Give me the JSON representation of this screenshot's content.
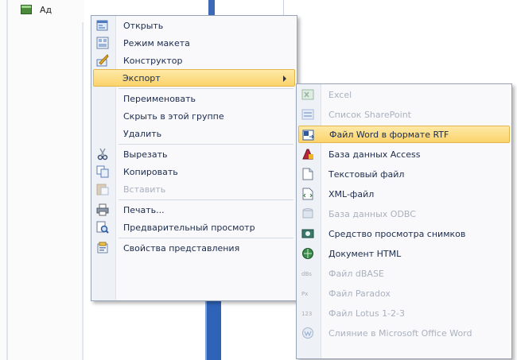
{
  "background": {
    "nav_item_label": "Ад"
  },
  "context_menu": {
    "items": [
      {
        "label": "Открыть",
        "icon": "open-form-icon",
        "disabled": false
      },
      {
        "label": "Режим макета",
        "icon": "layout-view-icon",
        "disabled": false
      },
      {
        "label": "Конструктор",
        "icon": "design-view-icon",
        "disabled": false
      },
      {
        "label": "Экспорт",
        "icon": "",
        "disabled": false,
        "highlighted": true,
        "submenu": true
      },
      {
        "label": "Переименовать",
        "icon": "",
        "disabled": false
      },
      {
        "label": "Скрыть в этой группе",
        "icon": "",
        "disabled": false
      },
      {
        "label": "Удалить",
        "icon": "",
        "disabled": false
      },
      {
        "label": "Вырезать",
        "icon": "scissors-icon",
        "disabled": false
      },
      {
        "label": "Копировать",
        "icon": "copy-icon",
        "disabled": false
      },
      {
        "label": "Вставить",
        "icon": "paste-icon",
        "disabled": true
      },
      {
        "label": "Печать...",
        "icon": "printer-icon",
        "disabled": false
      },
      {
        "label": "Предварительный просмотр",
        "icon": "print-preview-icon",
        "disabled": false
      },
      {
        "label": "Свойства представления",
        "icon": "properties-icon",
        "disabled": false
      }
    ]
  },
  "export_submenu": {
    "items": [
      {
        "label": "Excel",
        "icon": "excel-icon",
        "disabled": true
      },
      {
        "label": "Список SharePoint",
        "icon": "sharepoint-icon",
        "disabled": true
      },
      {
        "label": "Файл Word в формате RTF",
        "icon": "word-rtf-icon",
        "disabled": false,
        "highlighted": true
      },
      {
        "label": "База данных Access",
        "icon": "access-icon",
        "disabled": false
      },
      {
        "label": "Текстовый файл",
        "icon": "text-file-icon",
        "disabled": false
      },
      {
        "label": "XML-файл",
        "icon": "xml-file-icon",
        "disabled": false
      },
      {
        "label": "База данных ODBC",
        "icon": "odbc-icon",
        "disabled": true
      },
      {
        "label": "Средство просмотра снимков",
        "icon": "snapshot-viewer-icon",
        "disabled": false
      },
      {
        "label": "Документ HTML",
        "icon": "html-icon",
        "disabled": false
      },
      {
        "label": "Файл dBASE",
        "icon": "dbase-icon",
        "disabled": true
      },
      {
        "label": "Файл Paradox",
        "icon": "paradox-icon",
        "disabled": true
      },
      {
        "label": "Файл Lotus 1-2-3",
        "icon": "lotus-icon",
        "disabled": true
      },
      {
        "label": "Слияние в Microsoft Office Word",
        "icon": "word-merge-icon",
        "disabled": true
      }
    ]
  },
  "colors": {
    "highlight": "#fbd36b",
    "disabled_text": "#a9b1bf",
    "menu_text": "#1b2b4c",
    "menu_border": "#97a3b6"
  }
}
